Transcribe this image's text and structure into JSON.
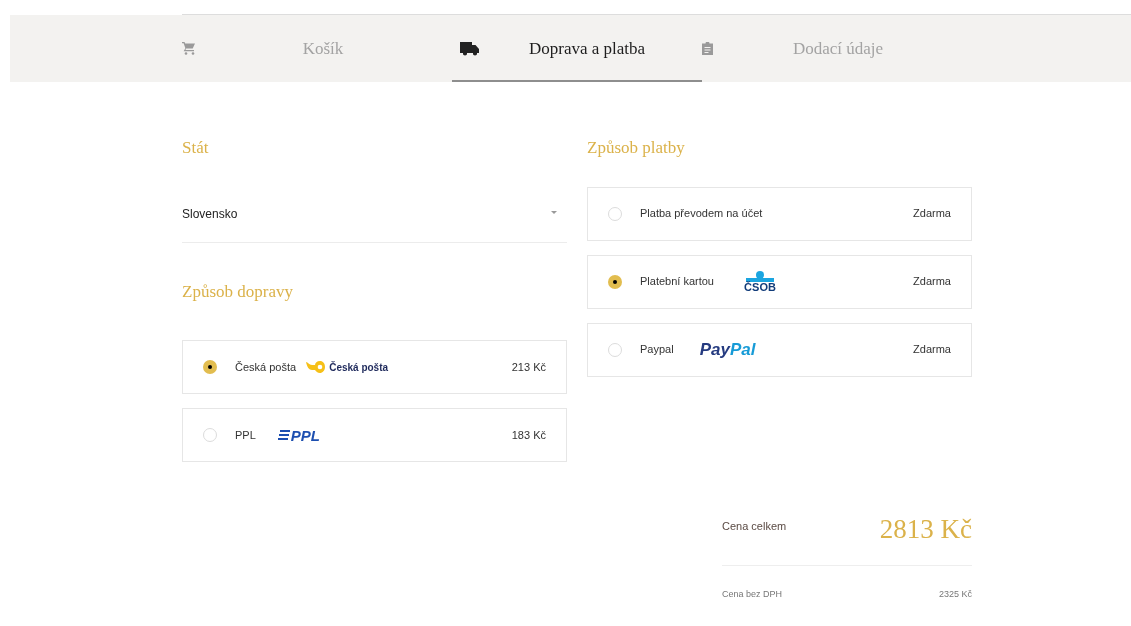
{
  "steps": [
    {
      "label": "Košík",
      "kind": "cart",
      "selected": false
    },
    {
      "label": "Doprava a platba",
      "kind": "truck",
      "selected": true
    },
    {
      "label": "Dodací údaje",
      "kind": "clipboard",
      "selected": false
    }
  ],
  "country": {
    "heading": "Stát",
    "value": "Slovensko"
  },
  "shipping": {
    "heading": "Způsob dopravy",
    "options": [
      {
        "label": "Česká pošta",
        "kind": "posta",
        "logo_parts": [
          "Česká pošta"
        ],
        "price": "213 Kč",
        "selected": true
      },
      {
        "label": "PPL",
        "kind": "ppl",
        "logo_parts": [
          "PPL"
        ],
        "price": "183 Kč",
        "selected": false
      }
    ]
  },
  "payment": {
    "heading": "Způsob platby",
    "options": [
      {
        "label": "Platba převodem na účet",
        "price": "Zdarma",
        "selected": false
      },
      {
        "label": "Platební kartou",
        "kind": "csob",
        "logo_parts": [
          "ČSOB"
        ],
        "price": "Zdarma",
        "selected": true
      },
      {
        "label": "Paypal",
        "kind": "paypal",
        "logo_parts": [
          "Pay",
          "Pal"
        ],
        "price": "Zdarma",
        "selected": false
      }
    ]
  },
  "summary": {
    "total_label": "Cena celkem",
    "total": "2813 Kč",
    "net_label": "Cena bez DPH",
    "net": "2325 Kč"
  }
}
